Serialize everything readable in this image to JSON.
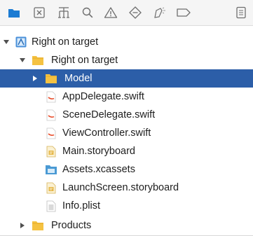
{
  "toolbar": {
    "icons": [
      "folder-icon",
      "source-control-icon",
      "hierarchy-icon",
      "search-icon",
      "warning-icon",
      "test-icon",
      "debug-icon",
      "breakpoint-icon",
      "report-icon"
    ],
    "accent_color": "#1b7bd3"
  },
  "tree": {
    "project": {
      "label": "Right on target",
      "expanded": true
    },
    "group": {
      "label": "Right on target",
      "expanded": true
    },
    "items": [
      {
        "label": "Model",
        "kind": "folder",
        "selected": true
      },
      {
        "label": "AppDelegate.swift",
        "kind": "swift"
      },
      {
        "label": "SceneDelegate.swift",
        "kind": "swift"
      },
      {
        "label": "ViewController.swift",
        "kind": "swift"
      },
      {
        "label": "Main.storyboard",
        "kind": "storyboard"
      },
      {
        "label": "Assets.xcassets",
        "kind": "assets"
      },
      {
        "label": "LaunchScreen.storyboard",
        "kind": "storyboard"
      },
      {
        "label": "Info.plist",
        "kind": "plist"
      }
    ],
    "products": {
      "label": "Products",
      "expanded": false
    }
  },
  "colors": {
    "selection": "#2c5ea8",
    "folder": "#f5c242",
    "swift": "#e8502e",
    "storyboard": "#e6b84a",
    "assets": "#4a9ad4"
  }
}
